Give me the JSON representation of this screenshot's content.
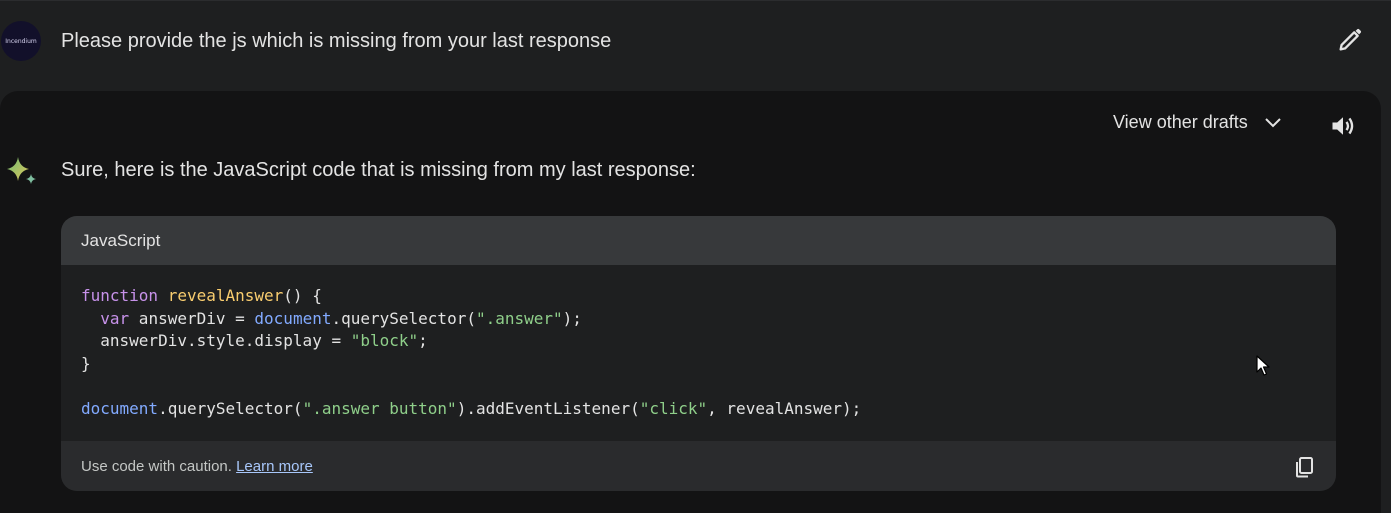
{
  "user_prompt": {
    "avatar_text": "Incendium",
    "text": "Please provide the js which is missing from your last response"
  },
  "response": {
    "drafts_label": "View other drafts",
    "intro": "Sure, here is the JavaScript code that is missing from my last response:",
    "code": {
      "language": "JavaScript",
      "lines": [
        "function revealAnswer() {",
        "  var answerDiv = document.querySelector(\".answer\");",
        "  answerDiv.style.display = \"block\";",
        "}",
        "",
        "document.querySelector(\".answer button\").addEventListener(\"click\", revealAnswer);"
      ],
      "caution_text": "Use code with caution.",
      "learn_more": "Learn more"
    }
  },
  "icons": {
    "edit": "pencil-icon",
    "drafts_toggle": "chevron-down-icon",
    "speaker": "speaker-icon",
    "gemini": "sparkle-icon",
    "copy": "copy-icon"
  },
  "colors": {
    "background": "#1e1f20",
    "panel": "#131314",
    "code_header": "#37393b",
    "link": "#a8c7fa",
    "keyword": "#c792ea",
    "function_name": "#f9cd6f",
    "builtin": "#82aaff",
    "string": "#8fcf8a"
  }
}
